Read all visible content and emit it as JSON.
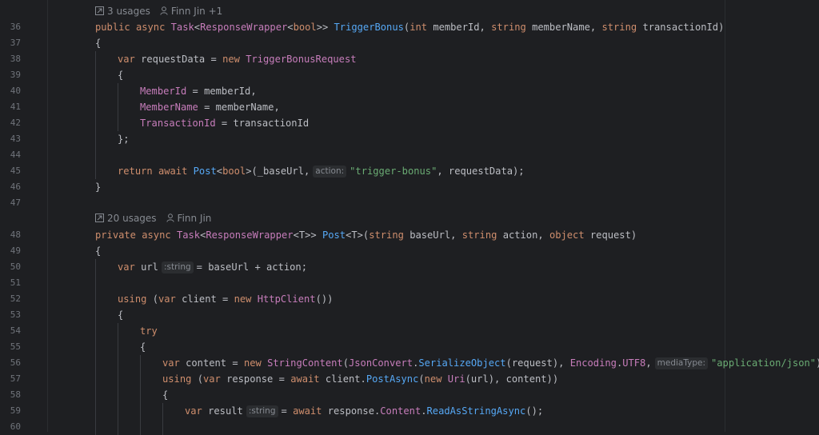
{
  "lenses": {
    "first": {
      "usages": "3 usages",
      "author": "Finn Jin +1"
    },
    "second": {
      "usages": "20 usages",
      "author": "Finn Jin"
    }
  },
  "line_numbers": [
    "36",
    "37",
    "38",
    "39",
    "40",
    "41",
    "42",
    "43",
    "44",
    "45",
    "46",
    "47",
    "48",
    "49",
    "50",
    "51",
    "52",
    "53",
    "54",
    "55",
    "56",
    "57",
    "58",
    "59",
    "60"
  ],
  "code": {
    "l36": [
      {
        "t": "public async ",
        "c": "kw"
      },
      {
        "t": "Task",
        "c": "ty"
      },
      {
        "t": "<",
        "c": "pl"
      },
      {
        "t": "ResponseWrapper",
        "c": "ty"
      },
      {
        "t": "<",
        "c": "pl"
      },
      {
        "t": "bool",
        "c": "kw"
      },
      {
        "t": ">> ",
        "c": "pl"
      },
      {
        "t": "TriggerBonus",
        "c": "fn"
      },
      {
        "t": "(",
        "c": "pl"
      },
      {
        "t": "int ",
        "c": "kw"
      },
      {
        "t": "memberId, ",
        "c": "pl"
      },
      {
        "t": "string ",
        "c": "kw"
      },
      {
        "t": "memberName, ",
        "c": "pl"
      },
      {
        "t": "string ",
        "c": "kw"
      },
      {
        "t": "transactionId)",
        "c": "pl"
      }
    ],
    "l37": [
      {
        "t": "{",
        "c": "pl"
      }
    ],
    "l38": [
      {
        "t": "var ",
        "c": "kw"
      },
      {
        "t": "requestData = ",
        "c": "pl"
      },
      {
        "t": "new ",
        "c": "kw"
      },
      {
        "t": "TriggerBonusRequest",
        "c": "ty"
      }
    ],
    "l39": [
      {
        "t": "{",
        "c": "pl"
      }
    ],
    "l40": [
      {
        "t": "MemberId",
        "c": "prop"
      },
      {
        "t": " = memberId,",
        "c": "pl"
      }
    ],
    "l41": [
      {
        "t": "MemberName",
        "c": "prop"
      },
      {
        "t": " = memberName,",
        "c": "pl"
      }
    ],
    "l42": [
      {
        "t": "TransactionId",
        "c": "prop"
      },
      {
        "t": " = transactionId",
        "c": "pl"
      }
    ],
    "l43": [
      {
        "t": "};",
        "c": "pl"
      }
    ],
    "l45": [
      {
        "t": "return await ",
        "c": "kw"
      },
      {
        "t": "Post",
        "c": "fn"
      },
      {
        "t": "<",
        "c": "pl"
      },
      {
        "t": "bool",
        "c": "kw"
      },
      {
        "t": ">(_baseUrl,",
        "c": "pl"
      },
      {
        "h": "action:"
      },
      {
        "t": "\"trigger-bonus\"",
        "c": "st"
      },
      {
        "t": ", requestData);",
        "c": "pl"
      }
    ],
    "l46": [
      {
        "t": "}",
        "c": "pl"
      }
    ],
    "l48": [
      {
        "t": "private async ",
        "c": "kw"
      },
      {
        "t": "Task",
        "c": "ty"
      },
      {
        "t": "<",
        "c": "pl"
      },
      {
        "t": "ResponseWrapper",
        "c": "ty"
      },
      {
        "t": "<T>> ",
        "c": "pl"
      },
      {
        "t": "Post",
        "c": "fn"
      },
      {
        "t": "<T>(",
        "c": "pl"
      },
      {
        "t": "string ",
        "c": "kw"
      },
      {
        "t": "baseUrl, ",
        "c": "pl"
      },
      {
        "t": "string ",
        "c": "kw"
      },
      {
        "t": "action, ",
        "c": "pl"
      },
      {
        "t": "object ",
        "c": "kw"
      },
      {
        "t": "request)",
        "c": "pl"
      }
    ],
    "l49": [
      {
        "t": "{",
        "c": "pl"
      }
    ],
    "l50": [
      {
        "t": "var ",
        "c": "kw"
      },
      {
        "t": "url",
        "c": "pl"
      },
      {
        "h": ":string"
      },
      {
        "t": "= baseUrl + action;",
        "c": "pl"
      }
    ],
    "l52": [
      {
        "t": "using ",
        "c": "kw"
      },
      {
        "t": "(",
        "c": "pl"
      },
      {
        "t": "var ",
        "c": "kw"
      },
      {
        "t": "client = ",
        "c": "pl"
      },
      {
        "t": "new ",
        "c": "kw"
      },
      {
        "t": "HttpClient",
        "c": "ty"
      },
      {
        "t": "())",
        "c": "pl"
      }
    ],
    "l53": [
      {
        "t": "{",
        "c": "pl"
      }
    ],
    "l54": [
      {
        "t": "try",
        "c": "kw"
      }
    ],
    "l55": [
      {
        "t": "{",
        "c": "pl"
      }
    ],
    "l56": [
      {
        "t": "var ",
        "c": "kw"
      },
      {
        "t": "content = ",
        "c": "pl"
      },
      {
        "t": "new ",
        "c": "kw"
      },
      {
        "t": "StringContent",
        "c": "ty"
      },
      {
        "t": "(",
        "c": "pl"
      },
      {
        "t": "JsonConvert",
        "c": "ty"
      },
      {
        "t": ".",
        "c": "pl"
      },
      {
        "t": "SerializeObject",
        "c": "fn"
      },
      {
        "t": "(request), ",
        "c": "pl"
      },
      {
        "t": "Encoding",
        "c": "ty"
      },
      {
        "t": ".",
        "c": "pl"
      },
      {
        "t": "UTF8",
        "c": "prop"
      },
      {
        "t": ",",
        "c": "pl"
      },
      {
        "h": "mediaType:"
      },
      {
        "t": "\"application/json\"",
        "c": "st"
      },
      {
        "t": ");",
        "c": "pl"
      }
    ],
    "l57": [
      {
        "t": "using ",
        "c": "kw"
      },
      {
        "t": "(",
        "c": "pl"
      },
      {
        "t": "var ",
        "c": "kw"
      },
      {
        "t": "response = ",
        "c": "pl"
      },
      {
        "t": "await ",
        "c": "kw"
      },
      {
        "t": "client.",
        "c": "pl"
      },
      {
        "t": "PostAsync",
        "c": "fn"
      },
      {
        "t": "(",
        "c": "pl"
      },
      {
        "t": "new ",
        "c": "kw"
      },
      {
        "t": "Uri",
        "c": "ty"
      },
      {
        "t": "(url), content))",
        "c": "pl"
      }
    ],
    "l58": [
      {
        "t": "{",
        "c": "pl"
      }
    ],
    "l59": [
      {
        "t": "var ",
        "c": "kw"
      },
      {
        "t": "result",
        "c": "pl"
      },
      {
        "h": ":string"
      },
      {
        "t": "= ",
        "c": "pl"
      },
      {
        "t": "await ",
        "c": "kw"
      },
      {
        "t": "response.",
        "c": "pl"
      },
      {
        "t": "Content",
        "c": "prop"
      },
      {
        "t": ".",
        "c": "pl"
      },
      {
        "t": "ReadAsStringAsync",
        "c": "fn"
      },
      {
        "t": "();",
        "c": "pl"
      }
    ]
  }
}
